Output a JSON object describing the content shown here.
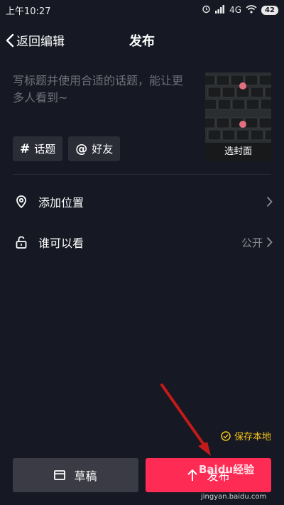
{
  "status_bar": {
    "time": "上午10:27",
    "network": "4G",
    "battery": "42"
  },
  "nav": {
    "back_label": "返回编辑",
    "title": "发布"
  },
  "caption": {
    "placeholder": "写标题并使用合适的话题，能让更多人看到~"
  },
  "cover": {
    "label": "选封面"
  },
  "chips": [
    {
      "icon": "#",
      "label": "话题"
    },
    {
      "icon": "@",
      "label": "好友"
    }
  ],
  "rows": [
    {
      "label": "添加位置",
      "value": ""
    },
    {
      "label": "谁可以看",
      "value": "公开"
    }
  ],
  "save_local": {
    "label": "保存本地",
    "checked": true
  },
  "buttons": {
    "draft": "草稿",
    "publish": "发布"
  },
  "colors": {
    "background": "#161823",
    "accent": "#fe2c55",
    "save_local": "#f5c518"
  },
  "watermark": {
    "brand": "Baidu经验",
    "site": "jingyan.baidu.com"
  }
}
